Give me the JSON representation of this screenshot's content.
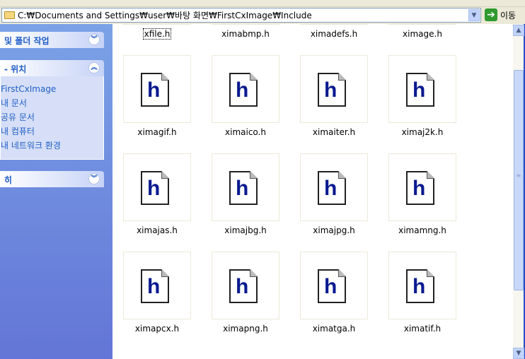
{
  "address": {
    "path": "C:₩Documents and Settings₩user₩바탕 화면₩FirstCxImage₩Include",
    "go_label": "이동"
  },
  "sidebar": {
    "sections": [
      {
        "title": "및 폴더 작업",
        "state": "collapsed"
      },
      {
        "title": "- 위치",
        "state": "expanded",
        "links": [
          "FirstCxImage",
          "내 문서",
          "공유 문서",
          "내 컴퓨터",
          "내 네트워크 환경"
        ]
      },
      {
        "title": "히",
        "state": "collapsed"
      }
    ]
  },
  "files": [
    "xfile.h",
    "ximabmp.h",
    "ximadefs.h",
    "ximage.h",
    "ximagif.h",
    "ximaico.h",
    "ximaiter.h",
    "ximaj2k.h",
    "ximajas.h",
    "ximajbg.h",
    "ximajpg.h",
    "ximamng.h",
    "ximapcx.h",
    "ximapng.h",
    "ximatga.h",
    "ximatif.h"
  ],
  "selected_file": "xfile.h",
  "icon_glyph": "h",
  "scrollbar": {
    "position_fraction": 0.07,
    "visible_fraction": 0.75
  }
}
